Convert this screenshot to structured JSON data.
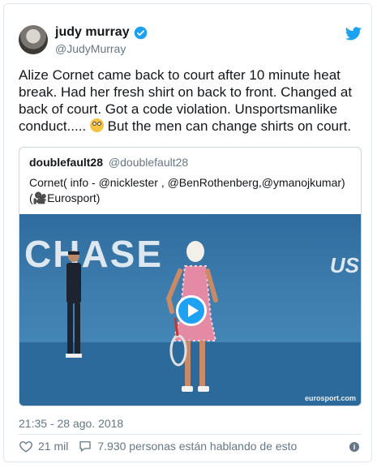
{
  "author": {
    "name": "judy murray",
    "handle": "@JudyMurray"
  },
  "tweet": {
    "text_before_emoji": "Alize Cornet came back to court after 10 minute heat break. Had her fresh shirt on back to front. Changed at back of court. Got a code violation. Unsportsmanlike conduct..... ",
    "emoji": "flushed-face",
    "text_after_emoji": " But the men can change shirts on court."
  },
  "quoted": {
    "name": "doublefault28",
    "handle": "@doublefault28",
    "text": "Cornet( info - @nicklester , @BenRothenberg,@ymanojkumar)(🎥Eurosport)",
    "video": {
      "wall_text": "CHASE",
      "side_text": "US",
      "watermark": "eurosport.com"
    }
  },
  "timestamp": "21:35 - 28 ago. 2018",
  "actions": {
    "likes": "21 mil",
    "talking": "7.930 personas están hablando de esto"
  },
  "colors": {
    "accent": "#1da1f2",
    "text": "#14171a",
    "muted": "#657786",
    "border": "#e1e8ed"
  }
}
